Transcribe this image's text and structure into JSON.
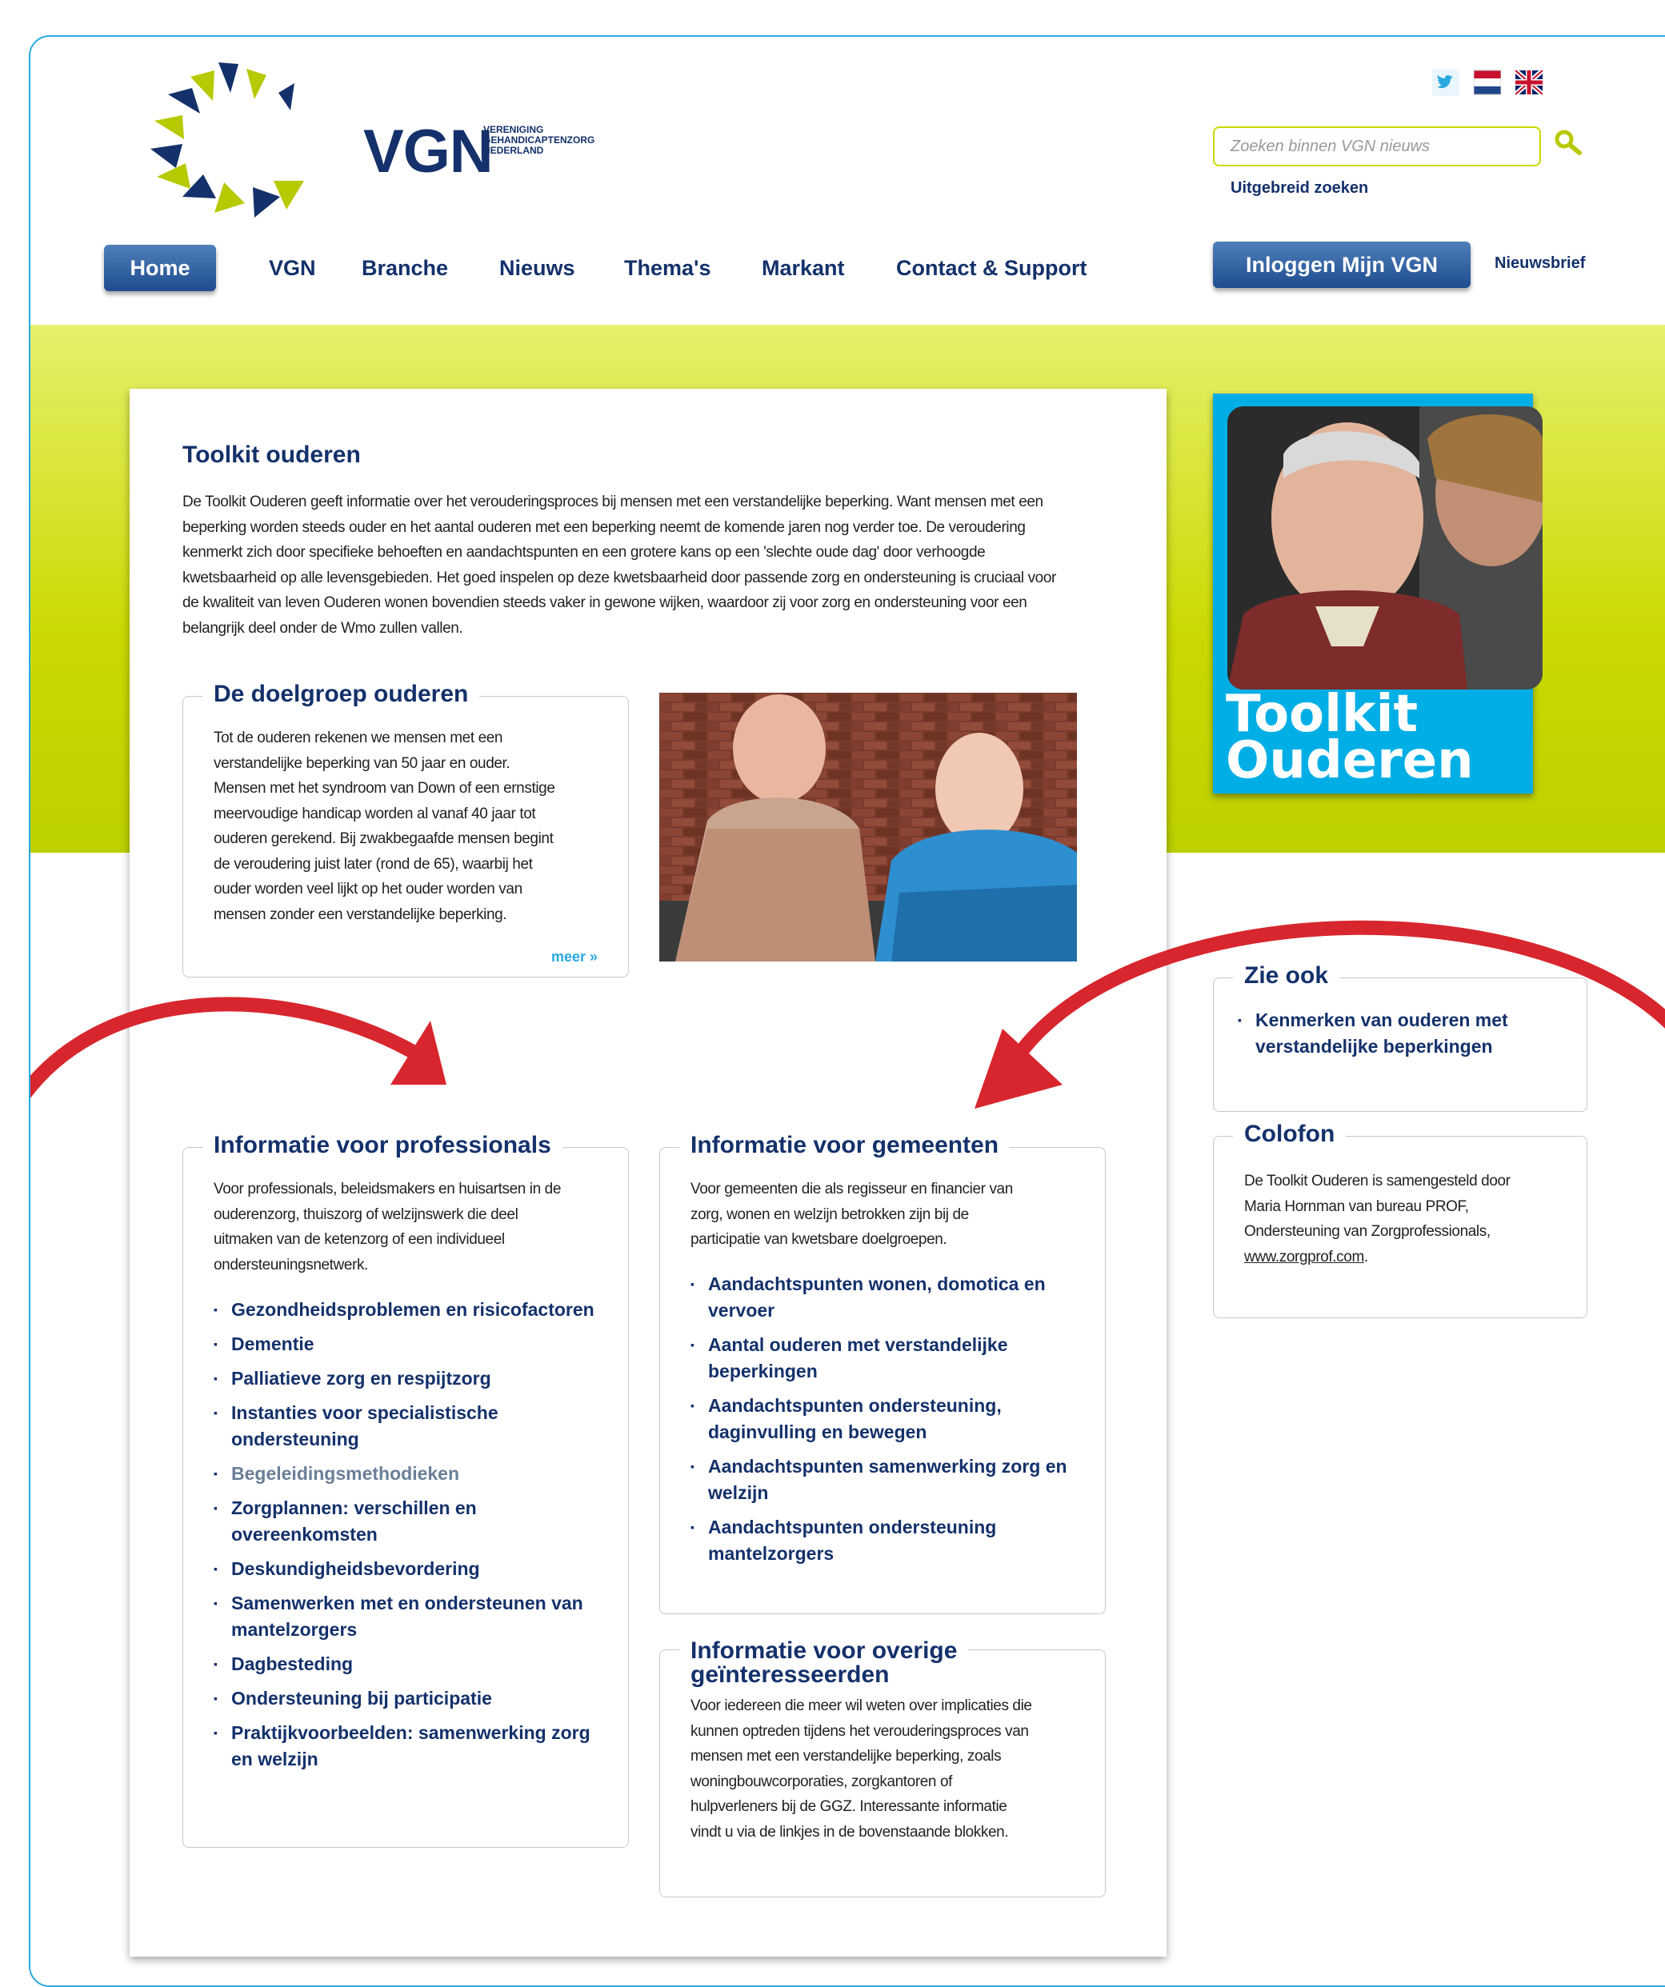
{
  "header": {
    "logo_text": "VGN",
    "logo_subtitle_1": "VERENIGING",
    "logo_subtitle_2": "GEHANDICAPTENZORG",
    "logo_subtitle_3": "NEDERLAND",
    "search_placeholder": "Zoeken binnen VGN nieuws",
    "advanced_search": "Uitgebreid zoeken",
    "login": "Inloggen Mijn VGN",
    "newsletter": "Nieuwsbrief"
  },
  "nav": {
    "home": "Home",
    "vgn": "VGN",
    "branche": "Branche",
    "nieuws": "Nieuws",
    "themas": "Thema's",
    "markant": "Markant",
    "contact": "Contact & Support"
  },
  "main": {
    "title": "Toolkit ouderen",
    "intro_1": "De Toolkit Ouderen geeft informatie over het verouderingsproces bij mensen met een verstandelijke beperking. Want mensen met een",
    "intro_2": "beperking worden steeds ouder en het aantal ouderen met een beperking neemt de komende jaren nog verder toe. De veroudering",
    "intro_3": "kenmerkt zich door specifieke behoeften en aandachtspunten en een grotere kans op een 'slechte oude dag' door verhoogde",
    "intro_4": "kwetsbaarheid op alle levensgebieden. Het goed inspelen op deze kwetsbaarheid door passende zorg en ondersteuning is cruciaal voor",
    "intro_5": "de kwaliteit van leven Ouderen wonen bovendien steeds vaker in gewone wijken, waardoor zij voor zorg en ondersteuning voor een",
    "intro_6": "belangrijk deel onder de Wmo zullen vallen."
  },
  "doelgroep": {
    "title": "De doelgroep ouderen",
    "lines": [
      "Tot de ouderen rekenen we mensen met een",
      "verstandelijke beperking van 50 jaar en ouder.",
      "Mensen met het syndroom van Down of een ernstige",
      "meervoudige handicap worden al vanaf 40 jaar tot",
      "ouderen gerekend. Bij zwakbegaafde mensen begint",
      "de veroudering juist later (rond de 65), waarbij het",
      "ouder worden veel lijkt op het ouder worden van",
      "mensen zonder een verstandelijke beperking."
    ],
    "more": "meer »"
  },
  "professionals": {
    "title": "Informatie voor professionals",
    "lines": [
      "Voor professionals, beleidsmakers en huisartsen in de",
      "ouderenzorg, thuiszorg of welzijnswerk die deel",
      "uitmaken van de ketenzorg of een individueel",
      "ondersteuningsnetwerk."
    ],
    "links": [
      "Gezondheidsproblemen en risicofactoren",
      "Dementie",
      "Palliatieve zorg en respijtzorg",
      "Instanties voor specialistische ondersteuning",
      "Begeleidingsmethodieken",
      "Zorgplannen: verschillen en overeenkomsten",
      "Deskundigheidsbevordering",
      "Samenwerken met en ondersteunen van mantelzorgers",
      "Dagbesteding",
      "Ondersteuning bij participatie",
      "Praktijkvoorbeelden: samenwerking zorg en welzijn"
    ]
  },
  "gemeenten": {
    "title": "Informatie voor gemeenten",
    "lines": [
      "Voor gemeenten die als regisseur en financier van",
      "zorg, wonen en welzijn betrokken zijn bij de",
      "participatie van kwetsbare doelgroepen."
    ],
    "links": [
      "Aandachtspunten wonen, domotica en vervoer",
      "Aantal ouderen met verstandelijke beperkingen",
      "Aandachtspunten ondersteuning, daginvulling en bewegen",
      "Aandachtspunten samenwerking zorg en welzijn",
      "Aandachtspunten ondersteuning mantelzorgers"
    ]
  },
  "overige": {
    "title_1": "Informatie voor overige",
    "title_2": "geïnteresseerden",
    "lines": [
      "Voor iedereen die meer wil weten over implicaties die",
      "kunnen optreden tijdens het verouderingsproces van",
      "mensen met een verstandelijke beperking, zoals",
      "woningbouwcorporaties, zorgkantoren of",
      "hulpverleners bij de GGZ. Interessante informatie",
      "vindt u via de linkjes in de bovenstaande blokken."
    ]
  },
  "sidebar": {
    "promo_title_1": "Toolkit",
    "promo_title_2": "Ouderen",
    "zie_ook_title": "Zie ook",
    "zie_ook_link": "Kenmerken van ouderen met verstandelijke beperkingen",
    "colofon_title": "Colofon",
    "colofon_1": "De Toolkit Ouderen is samengesteld door",
    "colofon_2": "Maria Hornman van bureau PROF,",
    "colofon_3": "Ondersteuning van Zorgprofessionals,",
    "colofon_link": "www.zorgprof.com",
    "colofon_end": "."
  },
  "colors": {
    "navy": "#14316b",
    "accent_blue": "#29a9e0",
    "lime": "#c9d900",
    "arrow_red": "#d8262e",
    "promo_cyan": "#00aee6"
  }
}
